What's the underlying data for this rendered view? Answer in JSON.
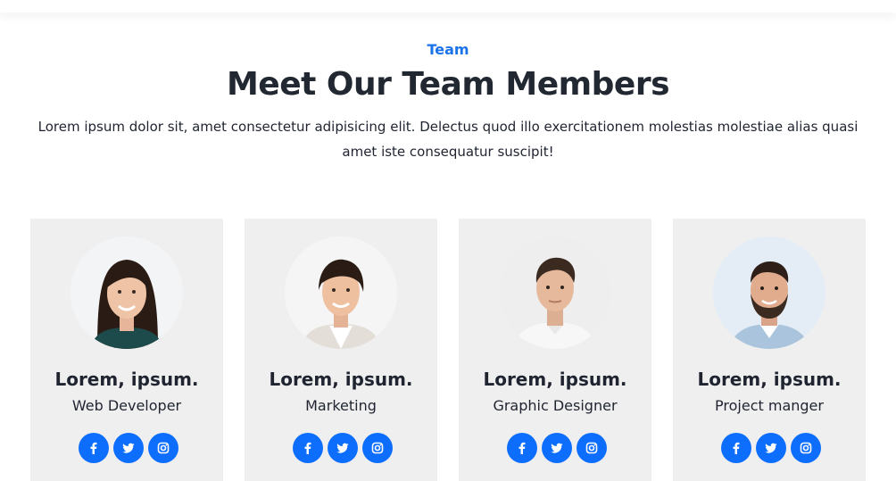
{
  "section": {
    "eyebrow": "Team",
    "title": "Meet Our Team Members",
    "description": "Lorem ipsum dolor sit, amet consectetur adipisicing elit. Delectus quod illo exercitationem molestias molestiae alias quasi amet iste consequatur suscipit!"
  },
  "members": [
    {
      "name": "Lorem, ipsum.",
      "role": "Web Developer",
      "photo": "woman-dark-hair-photo"
    },
    {
      "name": "Lorem, ipsum.",
      "role": "Marketing",
      "photo": "woman-ponytail-photo"
    },
    {
      "name": "Lorem, ipsum.",
      "role": "Graphic Designer",
      "photo": "man-white-shirt-photo"
    },
    {
      "name": "Lorem, ipsum.",
      "role": "Project manger",
      "photo": "man-beard-photo"
    }
  ],
  "social_icons": [
    "facebook-icon",
    "twitter-icon",
    "instagram-icon"
  ],
  "colors": {
    "accent": "#1a73e8",
    "social_button": "#0d6efd",
    "card_bg": "#efefef",
    "heading": "#222831"
  }
}
